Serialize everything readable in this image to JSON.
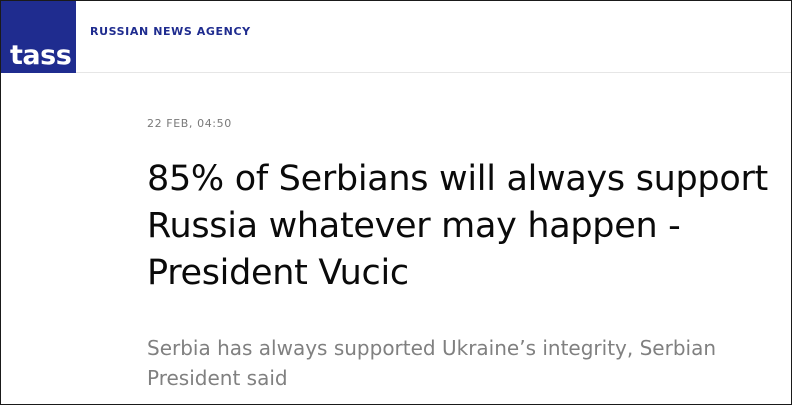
{
  "header": {
    "logo_text": "TASS",
    "agency_label": "RUSSIAN NEWS AGENCY",
    "brand_color": "#1f2c8f"
  },
  "article": {
    "date": "22 FEB, 04:50",
    "headline_lines": [
      "85% of Serbians will always support",
      "Russia whatever may happen -",
      "President Vucic"
    ],
    "lead": "Serbia has always supported Ukraine’s integrity, Serbian President said"
  }
}
